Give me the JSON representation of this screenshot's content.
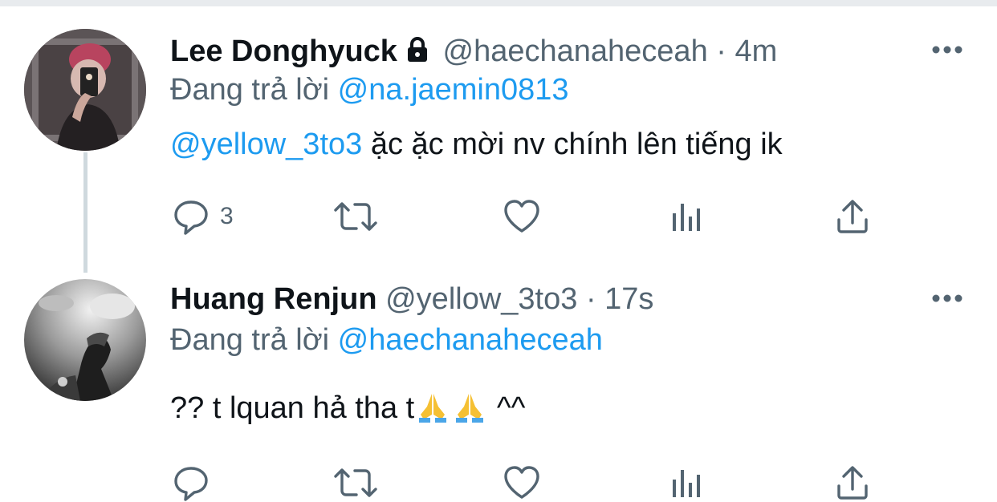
{
  "tweets": [
    {
      "name": "Lee Donghyuck",
      "protected_icon": "lock-icon",
      "handle": "@haechanaheceah",
      "separator": "·",
      "time": "4m",
      "reply_prefix": "Đang trả lời",
      "reply_to": "@na.jaemin0813",
      "mention": "@yellow_3to3",
      "text": " ặc ặc mời nv chính lên tiếng ik",
      "more_icon": "more-horizontal-icon",
      "actions": {
        "reply_icon": "reply-icon",
        "reply_count": "3",
        "retweet_icon": "retweet-icon",
        "like_icon": "heart-icon",
        "analytics_icon": "analytics-icon",
        "share_icon": "share-icon"
      }
    },
    {
      "name": "Huang Renjun",
      "handle": "@yellow_3to3",
      "separator": "·",
      "time": "17s",
      "reply_prefix": "Đang trả lời",
      "reply_to": "@haechanaheceah",
      "text_before": "?? t lquan hả tha t",
      "emoji_icon": "folded-hands-emoji",
      "text_after": "^^",
      "more_icon": "more-horizontal-icon",
      "actions": {
        "reply_icon": "reply-icon",
        "reply_count": "",
        "retweet_icon": "retweet-icon",
        "like_icon": "heart-icon",
        "analytics_icon": "analytics-icon",
        "share_icon": "share-icon"
      }
    }
  ],
  "colors": {
    "link": "#1d9bf0",
    "secondary_text": "#536471",
    "primary_text": "#0f1419",
    "thread_line": "#cfd9de"
  }
}
